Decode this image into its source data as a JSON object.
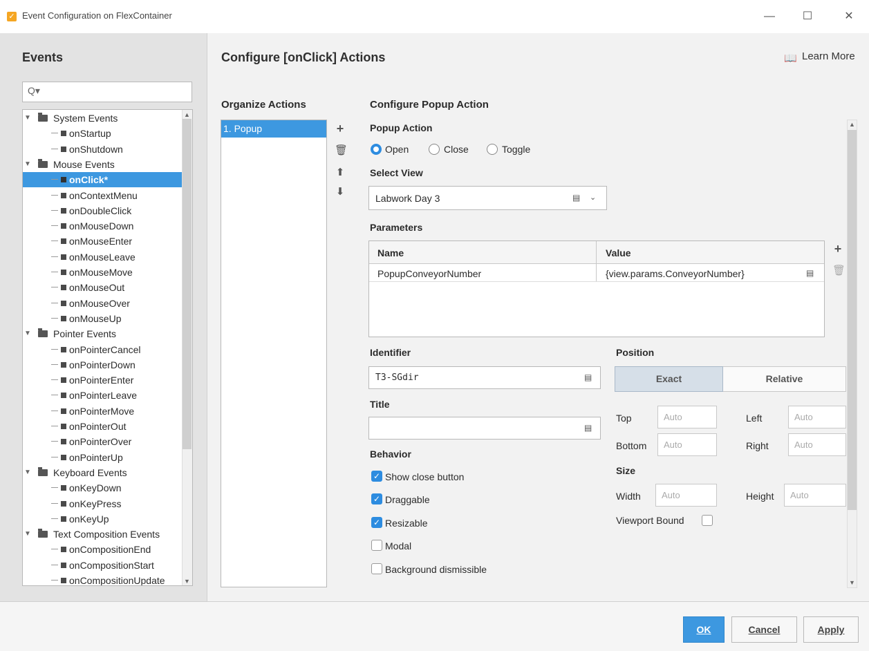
{
  "window": {
    "title": "Event Configuration on FlexContainer",
    "minimize": "—",
    "maximize": "☐",
    "close": "✕"
  },
  "left": {
    "heading": "Events",
    "search_icon": "Q▾",
    "tree": [
      {
        "type": "group",
        "label": "System Events"
      },
      {
        "type": "leaf",
        "label": "onStartup"
      },
      {
        "type": "leaf",
        "label": "onShutdown"
      },
      {
        "type": "group",
        "label": "Mouse Events"
      },
      {
        "type": "leaf",
        "label": "onClick*",
        "selected": true
      },
      {
        "type": "leaf",
        "label": "onContextMenu"
      },
      {
        "type": "leaf",
        "label": "onDoubleClick"
      },
      {
        "type": "leaf",
        "label": "onMouseDown"
      },
      {
        "type": "leaf",
        "label": "onMouseEnter"
      },
      {
        "type": "leaf",
        "label": "onMouseLeave"
      },
      {
        "type": "leaf",
        "label": "onMouseMove"
      },
      {
        "type": "leaf",
        "label": "onMouseOut"
      },
      {
        "type": "leaf",
        "label": "onMouseOver"
      },
      {
        "type": "leaf",
        "label": "onMouseUp"
      },
      {
        "type": "group",
        "label": "Pointer Events"
      },
      {
        "type": "leaf",
        "label": "onPointerCancel"
      },
      {
        "type": "leaf",
        "label": "onPointerDown"
      },
      {
        "type": "leaf",
        "label": "onPointerEnter"
      },
      {
        "type": "leaf",
        "label": "onPointerLeave"
      },
      {
        "type": "leaf",
        "label": "onPointerMove"
      },
      {
        "type": "leaf",
        "label": "onPointerOut"
      },
      {
        "type": "leaf",
        "label": "onPointerOver"
      },
      {
        "type": "leaf",
        "label": "onPointerUp"
      },
      {
        "type": "group",
        "label": "Keyboard Events"
      },
      {
        "type": "leaf",
        "label": "onKeyDown"
      },
      {
        "type": "leaf",
        "label": "onKeyPress"
      },
      {
        "type": "leaf",
        "label": "onKeyUp"
      },
      {
        "type": "group",
        "label": "Text Composition Events"
      },
      {
        "type": "leaf",
        "label": "onCompositionEnd"
      },
      {
        "type": "leaf",
        "label": "onCompositionStart"
      },
      {
        "type": "leaf",
        "label": "onCompositionUpdate"
      }
    ]
  },
  "main": {
    "title": "Configure [onClick] Actions",
    "learn_more": "Learn More",
    "organize_title": "Organize Actions",
    "actions": [
      "1. Popup"
    ],
    "config_title": "Configure Popup Action",
    "popup_action_label": "Popup Action",
    "popup_options": [
      "Open",
      "Close",
      "Toggle"
    ],
    "popup_selected": "Open",
    "select_view_label": "Select View",
    "select_view_value": "Labwork Day 3",
    "parameters_label": "Parameters",
    "params_headers": [
      "Name",
      "Value"
    ],
    "params_rows": [
      [
        "PopupConveyorNumber",
        "{view.params.ConveyorNumber}"
      ]
    ],
    "identifier_label": "Identifier",
    "identifier_value": "T3-SGdir",
    "title_label": "Title",
    "title_value": "",
    "behavior_label": "Behavior",
    "behavior": [
      {
        "label": "Show close button",
        "checked": true
      },
      {
        "label": "Draggable",
        "checked": true
      },
      {
        "label": "Resizable",
        "checked": true
      },
      {
        "label": "Modal",
        "checked": false
      },
      {
        "label": "Background dismissible",
        "checked": false
      }
    ],
    "position_label": "Position",
    "position_modes": [
      "Exact",
      "Relative"
    ],
    "position_selected": "Exact",
    "top_label": "Top",
    "left_label": "Left",
    "bottom_label": "Bottom",
    "right_label": "Right",
    "size_label": "Size",
    "width_label": "Width",
    "height_label": "Height",
    "auto_placeholder": "Auto",
    "viewport_bound_label": "Viewport Bound",
    "viewport_bound": false
  },
  "footer": {
    "ok": "OK",
    "cancel": "Cancel",
    "apply": "Apply"
  },
  "colors": {
    "accent": "#3d98e0",
    "panel_bg": "#e3e3e3",
    "body_bg": "#f2f2f2"
  }
}
